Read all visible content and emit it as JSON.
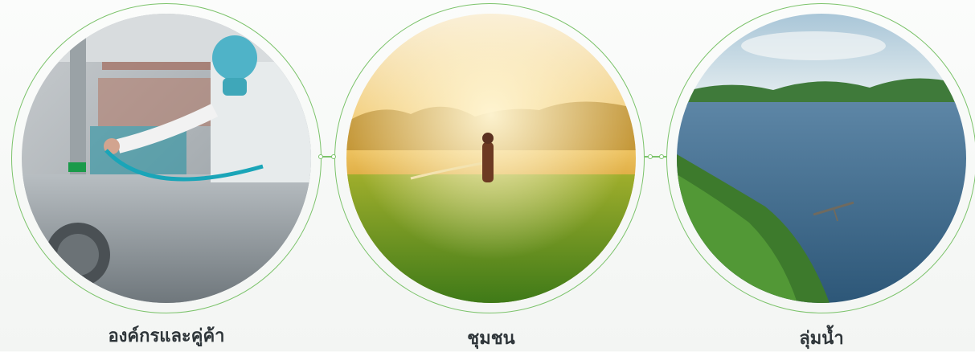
{
  "sections": [
    {
      "label": "องค์กรและคู่ค้า",
      "image": "factory-worker-cleaning-photo"
    },
    {
      "label": "ชุมชน",
      "image": "farmer-spraying-rice-field-photo"
    },
    {
      "label": "ลุ่มน้ำ",
      "image": "river-landscape-photo"
    }
  ],
  "colors": {
    "accent": "#7cc36b",
    "caption": "#2e3539"
  }
}
